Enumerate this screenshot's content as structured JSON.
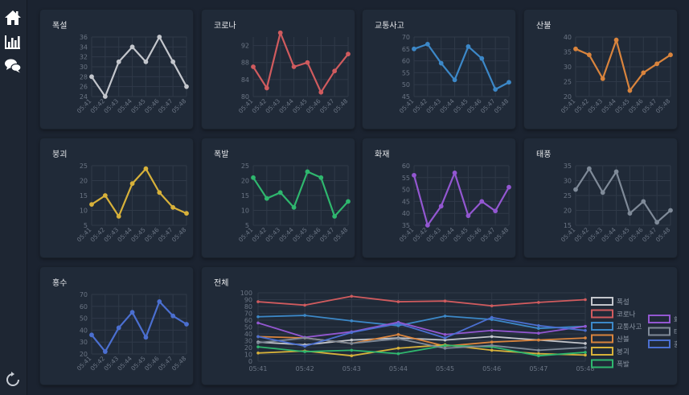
{
  "icons": {
    "home": "home-icon",
    "chart": "bar-chart-icon",
    "chat": "chat-icon",
    "refresh": "refresh-icon"
  },
  "time_labels": [
    "05:41",
    "05:42",
    "05:43",
    "05:44",
    "05:45",
    "05:46",
    "05:47",
    "05:48"
  ],
  "panels": [
    {
      "id": "snow",
      "title": "폭설",
      "color": "#c3c6cc",
      "values": [
        28,
        24,
        31,
        34,
        31,
        36,
        31,
        26
      ],
      "ylim": [
        24,
        36
      ],
      "yticks": [
        24,
        26,
        28,
        30,
        32,
        34,
        36
      ]
    },
    {
      "id": "corona",
      "title": "코로나",
      "color": "#d05b5e",
      "values": [
        87,
        82,
        95,
        87,
        88,
        81,
        86,
        90
      ],
      "ylim": [
        80,
        94
      ],
      "yticks": [
        80,
        84,
        88,
        92
      ]
    },
    {
      "id": "traffic",
      "title": "교통사고",
      "color": "#3c88c8",
      "values": [
        65,
        67,
        59,
        52,
        66,
        61,
        48,
        51
      ],
      "ylim": [
        45,
        70
      ],
      "yticks": [
        45,
        50,
        55,
        60,
        65,
        70
      ]
    },
    {
      "id": "landslide",
      "title": "산불",
      "color": "#d9843d",
      "values": [
        36,
        34,
        26,
        39,
        22,
        28,
        31,
        34
      ],
      "ylim": [
        20,
        40
      ],
      "yticks": [
        20,
        25,
        30,
        35,
        40
      ]
    },
    {
      "id": "collapse",
      "title": "붕괴",
      "color": "#d7b13a",
      "values": [
        12,
        15,
        8,
        19,
        24,
        16,
        11,
        9
      ],
      "ylim": [
        5,
        25
      ],
      "yticks": [
        5,
        10,
        15,
        20,
        25
      ]
    },
    {
      "id": "explosion",
      "title": "폭발",
      "color": "#2fb76e",
      "values": [
        21,
        14,
        16,
        11,
        23,
        21,
        8,
        13
      ],
      "ylim": [
        5,
        25
      ],
      "yticks": [
        5,
        10,
        15,
        20,
        25
      ]
    },
    {
      "id": "fire",
      "title": "화재",
      "color": "#9357d1",
      "values": [
        56,
        35,
        43,
        57,
        39,
        45,
        41,
        51
      ],
      "ylim": [
        35,
        60
      ],
      "yticks": [
        35,
        40,
        45,
        50,
        55,
        60
      ]
    },
    {
      "id": "typhoon",
      "title": "태풍",
      "color": "#7f8a98",
      "values": [
        27,
        34,
        26,
        33,
        19,
        23,
        16,
        20
      ],
      "ylim": [
        15,
        35
      ],
      "yticks": [
        15,
        20,
        25,
        30,
        35
      ]
    },
    {
      "id": "flood",
      "title": "홍수",
      "color": "#4b6fd0",
      "values": [
        36,
        22,
        42,
        55,
        34,
        64,
        52,
        45
      ],
      "ylim": [
        20,
        70
      ],
      "yticks": [
        20,
        30,
        40,
        50,
        60,
        70
      ]
    }
  ],
  "combined": {
    "title": "전체",
    "ylim": [
      0,
      100
    ],
    "yticks": [
      0,
      10,
      20,
      30,
      40,
      50,
      60,
      70,
      80,
      90,
      100
    ]
  },
  "chart_data": [
    {
      "type": "line",
      "title": "폭설",
      "x": [
        "05:41",
        "05:42",
        "05:43",
        "05:44",
        "05:45",
        "05:46",
        "05:47",
        "05:48"
      ],
      "values": [
        28,
        24,
        31,
        34,
        31,
        36,
        31,
        26
      ],
      "ylim": [
        24,
        36
      ]
    },
    {
      "type": "line",
      "title": "코로나",
      "x": [
        "05:41",
        "05:42",
        "05:43",
        "05:44",
        "05:45",
        "05:46",
        "05:47",
        "05:48"
      ],
      "values": [
        87,
        82,
        95,
        87,
        88,
        81,
        86,
        90
      ],
      "ylim": [
        80,
        94
      ]
    },
    {
      "type": "line",
      "title": "교통사고",
      "x": [
        "05:41",
        "05:42",
        "05:43",
        "05:44",
        "05:45",
        "05:46",
        "05:47",
        "05:48"
      ],
      "values": [
        65,
        67,
        59,
        52,
        66,
        61,
        48,
        51
      ],
      "ylim": [
        45,
        70
      ]
    },
    {
      "type": "line",
      "title": "산불",
      "x": [
        "05:41",
        "05:42",
        "05:43",
        "05:44",
        "05:45",
        "05:46",
        "05:47",
        "05:48"
      ],
      "values": [
        36,
        34,
        26,
        39,
        22,
        28,
        31,
        34
      ],
      "ylim": [
        20,
        40
      ]
    },
    {
      "type": "line",
      "title": "붕괴",
      "x": [
        "05:41",
        "05:42",
        "05:43",
        "05:44",
        "05:45",
        "05:46",
        "05:47",
        "05:48"
      ],
      "values": [
        12,
        15,
        8,
        19,
        24,
        16,
        11,
        9
      ],
      "ylim": [
        5,
        25
      ]
    },
    {
      "type": "line",
      "title": "폭발",
      "x": [
        "05:41",
        "05:42",
        "05:43",
        "05:44",
        "05:45",
        "05:46",
        "05:47",
        "05:48"
      ],
      "values": [
        21,
        14,
        16,
        11,
        23,
        21,
        8,
        13
      ],
      "ylim": [
        5,
        25
      ]
    },
    {
      "type": "line",
      "title": "화재",
      "x": [
        "05:41",
        "05:42",
        "05:43",
        "05:44",
        "05:45",
        "05:46",
        "05:47",
        "05:48"
      ],
      "values": [
        56,
        35,
        43,
        57,
        39,
        45,
        41,
        51
      ],
      "ylim": [
        35,
        60
      ]
    },
    {
      "type": "line",
      "title": "태풍",
      "x": [
        "05:41",
        "05:42",
        "05:43",
        "05:44",
        "05:45",
        "05:46",
        "05:47",
        "05:48"
      ],
      "values": [
        27,
        34,
        26,
        33,
        19,
        23,
        16,
        20
      ],
      "ylim": [
        15,
        35
      ]
    },
    {
      "type": "line",
      "title": "홍수",
      "x": [
        "05:41",
        "05:42",
        "05:43",
        "05:44",
        "05:45",
        "05:46",
        "05:47",
        "05:48"
      ],
      "values": [
        36,
        22,
        42,
        55,
        34,
        64,
        52,
        45
      ],
      "ylim": [
        20,
        70
      ]
    },
    {
      "type": "line",
      "title": "전체",
      "x": [
        "05:41",
        "05:42",
        "05:43",
        "05:44",
        "05:45",
        "05:46",
        "05:47",
        "05:48"
      ],
      "ylim": [
        0,
        100
      ],
      "legend": "right",
      "series": [
        {
          "name": "폭설",
          "values": [
            28,
            24,
            31,
            34,
            31,
            36,
            31,
            26
          ]
        },
        {
          "name": "코로나",
          "values": [
            87,
            82,
            95,
            87,
            88,
            81,
            86,
            90
          ]
        },
        {
          "name": "교통사고",
          "values": [
            65,
            67,
            59,
            52,
            66,
            61,
            48,
            51
          ]
        },
        {
          "name": "산불",
          "values": [
            36,
            34,
            26,
            39,
            22,
            28,
            31,
            34
          ]
        },
        {
          "name": "붕괴",
          "values": [
            12,
            15,
            8,
            19,
            24,
            16,
            11,
            9
          ]
        },
        {
          "name": "폭발",
          "values": [
            21,
            14,
            16,
            11,
            23,
            21,
            8,
            13
          ]
        },
        {
          "name": "화재",
          "values": [
            56,
            35,
            43,
            57,
            39,
            45,
            41,
            51
          ]
        },
        {
          "name": "태풍",
          "values": [
            27,
            34,
            26,
            33,
            19,
            23,
            16,
            20
          ]
        },
        {
          "name": "홍수",
          "values": [
            36,
            22,
            42,
            55,
            34,
            64,
            52,
            45
          ]
        }
      ]
    }
  ]
}
